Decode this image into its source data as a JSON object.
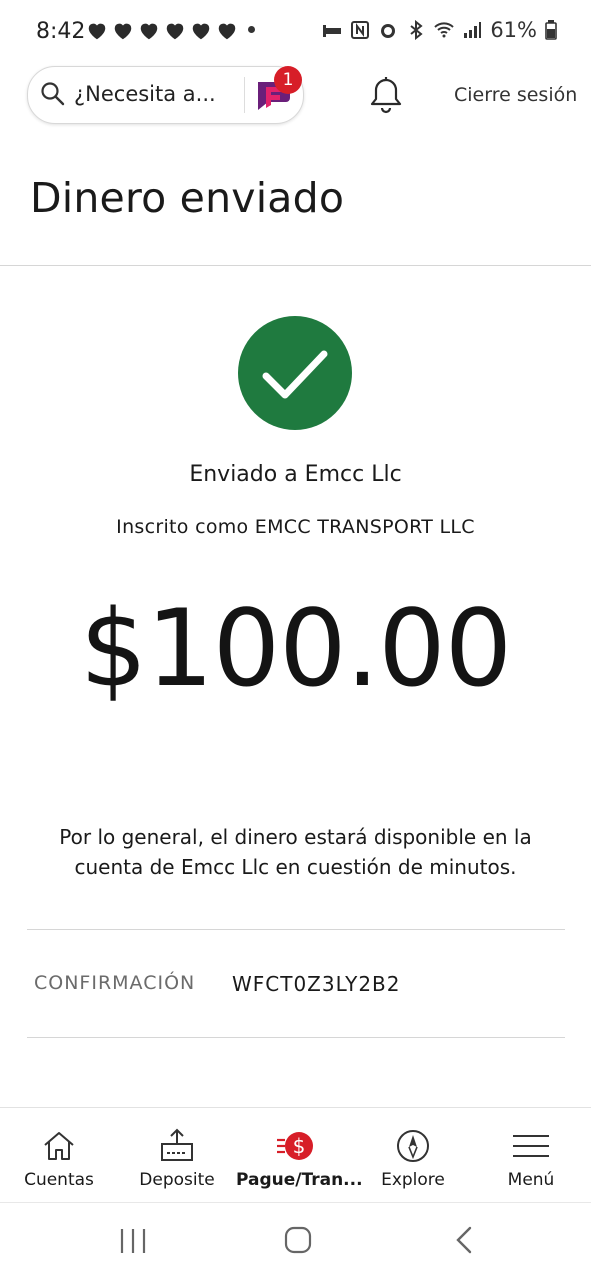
{
  "status_bar": {
    "time": "8:42",
    "battery": "61%"
  },
  "header": {
    "search_placeholder": "¿Necesita a...",
    "notification_count": "1",
    "sign_out": "Cierre sesión"
  },
  "page": {
    "title": "Dinero enviado"
  },
  "confirmation": {
    "sent_to": "Enviado a Emcc Llc",
    "enrolled_as": "Inscrito como EMCC TRANSPORT LLC",
    "amount": "$100.00",
    "note": "Por lo general, el dinero estará disponible en la cuenta de Emcc Llc en cuestión de minutos.",
    "code_label": "CONFIRMACIÓN",
    "code_value": "WFCT0Z3LY2B2"
  },
  "bottom_nav": {
    "items": [
      {
        "label": "Cuentas",
        "icon": "home-icon"
      },
      {
        "label": "Deposite",
        "icon": "deposit-icon"
      },
      {
        "label": "Pague/Tran...",
        "icon": "pay-transfer-icon"
      },
      {
        "label": "Explore",
        "icon": "compass-icon"
      },
      {
        "label": "Menú",
        "icon": "menu-icon"
      }
    ]
  },
  "colors": {
    "success_green": "#1f7a3f",
    "brand_red": "#d71e28",
    "fargo_purple": "#6a1f7a",
    "fargo_pink": "#e2226b"
  }
}
